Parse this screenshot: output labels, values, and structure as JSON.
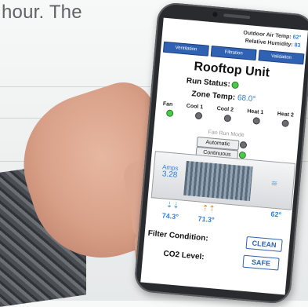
{
  "background": {
    "text": "hour. The"
  },
  "app": {
    "outdoor_air_label": "Outdoor Air Temp:",
    "outdoor_air_value": "62°",
    "humidity_label": "Relative Humidity:",
    "humidity_value": "83",
    "tabs": [
      {
        "label": "Ventilation"
      },
      {
        "label": "Filtration"
      },
      {
        "label": "Validation"
      }
    ],
    "title": "Rooftop Unit",
    "run_status_label": "Run Status:",
    "zone_temp_label": "Zone Temp:",
    "zone_temp_value": "68.0°",
    "stages": [
      {
        "label": "Fan",
        "state": "on"
      },
      {
        "label": "Cool 1",
        "state": "off"
      },
      {
        "label": "Cool 2",
        "state": "off"
      },
      {
        "label": "Heat 1",
        "state": "off"
      },
      {
        "label": "Heat 2",
        "state": "off"
      }
    ],
    "fan_mode_label": "Fan Run Mode",
    "fan_mode_automatic": "Automatic",
    "fan_mode_continuous": "Continuous",
    "amps_label": "Amps",
    "amps_value": "3.28",
    "outdoor_side_temp": "62°",
    "supply_temp": "74.3°",
    "return_temp": "71.3°",
    "filter_label": "Filter Condition:",
    "filter_value": "CLEAN",
    "co2_label": "CO2 Level:",
    "co2_value": "SAFE"
  },
  "colors": {
    "accent": "#2f7fd8",
    "tab": "#2f62b2",
    "led_on": "#4cc94a",
    "led_off": "#6b6d70"
  }
}
